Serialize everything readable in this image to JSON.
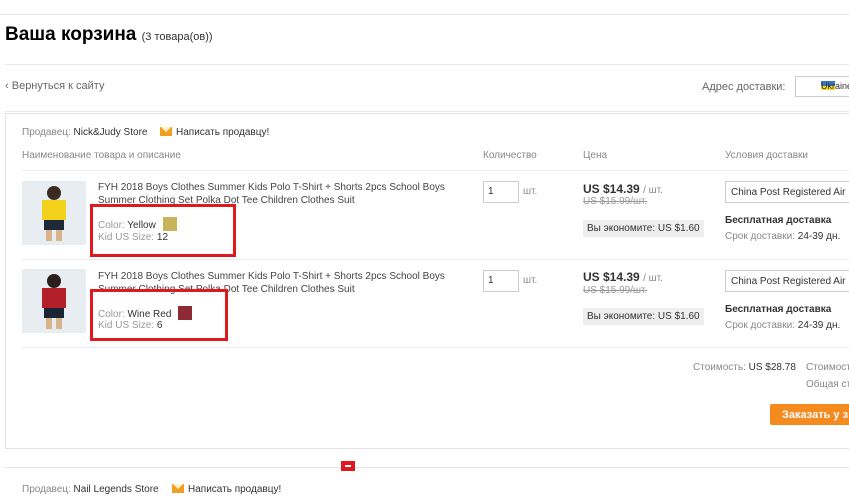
{
  "cart": {
    "title": "Ваша корзина",
    "count_text": "(3 товара(ов))"
  },
  "nav": {
    "back_link": "Вернуться к сайту"
  },
  "shipping": {
    "label": "Адрес доставки:",
    "country": "Ukraine"
  },
  "store1": {
    "seller_label": "Продавец:",
    "seller_name": "Nick&Judy Store",
    "contact": "Написать продавцу!",
    "headers": {
      "product": "Наименование товара и описание",
      "quantity": "Количество",
      "price": "Цена",
      "delivery": "Условия доставки"
    },
    "items": [
      {
        "title": "FYH 2018 Boys Clothes Summer Kids Polo T-Shirt + Shorts 2pcs School Boys Summer Clothing Set Polka Dot Tee Children Clothes Suit",
        "color_label": "Color:",
        "color_value": "Yellow",
        "size_label": "Kid US Size:",
        "size_value": "12",
        "quantity": "1",
        "unit": "шт.",
        "price": "US $14.39",
        "per_unit": "/ шт.",
        "old_price": "US $15.99/шт.",
        "savings": "Вы экономите: US $1.60",
        "delivery_method": "China Post Registered Air Mail",
        "free_shipping": "Бесплатная доставка",
        "delivery_time_label": "Срок доставки:",
        "delivery_time_value": "24-39 дн."
      },
      {
        "title": "FYH 2018 Boys Clothes Summer Kids Polo T-Shirt + Shorts 2pcs School Boys Summer Clothing Set Polka Dot Tee Children Clothes Suit",
        "color_label": "Color:",
        "color_value": "Wine Red",
        "size_label": "Kid US Size:",
        "size_value": "6",
        "quantity": "1",
        "unit": "шт.",
        "price": "US $14.39",
        "per_unit": "/ шт.",
        "old_price": "US $15.99/шт.",
        "savings": "Вы экономите: US $1.60",
        "delivery_method": "China Post Registered Air Mail",
        "free_shipping": "Бесплатная доставка",
        "delivery_time_label": "Срок доставки:",
        "delivery_time_value": "24-39 дн."
      }
    ],
    "subtotal_label": "Стоимость:",
    "subtotal_value": "US $28.78",
    "shipping_cost_label": "Стоимость",
    "total_label": "Общая сто",
    "order_button": "Заказать у з"
  },
  "store2": {
    "seller_label": "Продавец:",
    "seller_name": "Nail Legends Store",
    "contact": "Написать продавцу!"
  },
  "colors": {
    "accent": "#f58a1f",
    "highlight": "#e0191f"
  }
}
